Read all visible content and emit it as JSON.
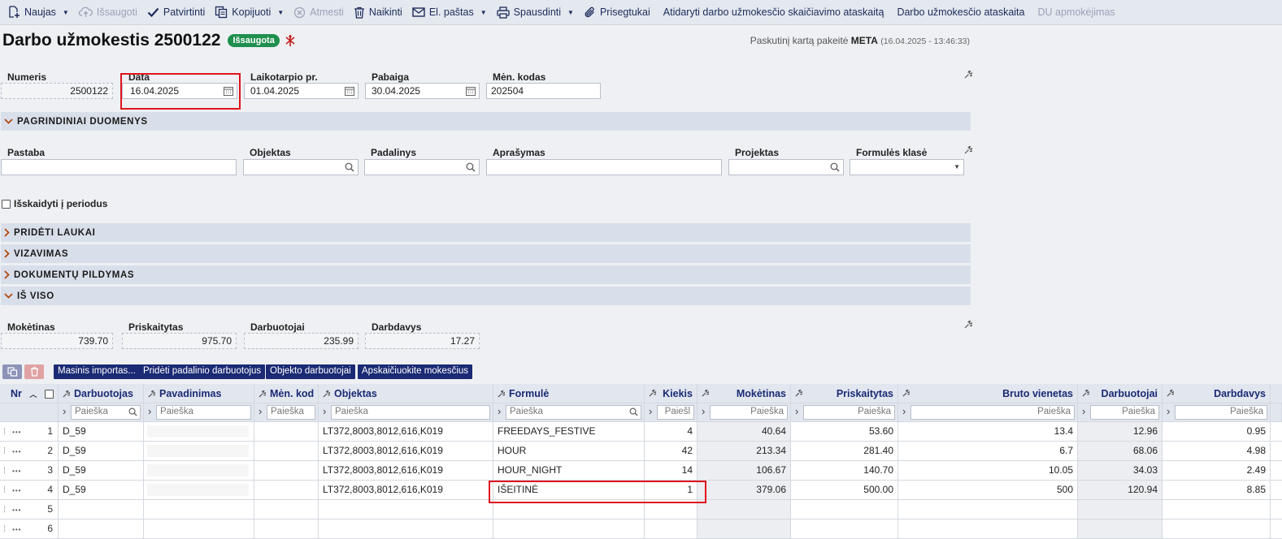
{
  "toolbar": {
    "new": "Naujas",
    "save": "Išsaugoti",
    "confirm": "Patvirtinti",
    "copy": "Kopijuoti",
    "cancel": "Atmesti",
    "delete": "Naikinti",
    "email": "El. paštas",
    "print": "Spausdinti",
    "attachments": "Prisegtukai",
    "report_calc": "Atidaryti darbo užmokesčio skaičiavimo ataskaitą",
    "report": "Darbo užmokesčio ataskaita",
    "payments": "DU apmokėjimas"
  },
  "header": {
    "title": "Darbo užmokestis 2500122",
    "status": "Išsaugota",
    "last_changed_prefix": "Paskutinį kartą pakeitė",
    "last_changed_user": "META",
    "last_changed_time": "(16.04.2025 - 13:46:33)"
  },
  "fields": {
    "number_label": "Numeris",
    "number": "2500122",
    "date_label": "Data",
    "date": "16.04.2025",
    "period_start_label": "Laikotarpio pr.",
    "period_start": "01.04.2025",
    "period_end_label": "Pabaiga",
    "period_end": "30.04.2025",
    "month_code_label": "Mėn. kodas",
    "month_code": "202504"
  },
  "sections": {
    "main": "PAGRINDINIAI DUOMENYS",
    "added": "PRIDĖTI LAUKAI",
    "approval": "VIZAVIMAS",
    "filling": "DOKUMENTŲ PILDYMAS",
    "total": "IŠ VISO"
  },
  "main_fields": {
    "note_label": "Pastaba",
    "note": "",
    "object_label": "Objektas",
    "object": "",
    "department_label": "Padalinys",
    "department": "",
    "description_label": "Aprašymas",
    "description": "",
    "project_label": "Projektas",
    "project": "",
    "formula_class_label": "Formulės klasė",
    "formula_class": ""
  },
  "split_period_label": "Išskaidyti į periodus",
  "totals": {
    "payable_label": "Mokėtinas",
    "payable": "739.70",
    "accrued_label": "Priskaitytas",
    "accrued": "975.70",
    "employees_label": "Darbuotojai",
    "employees": "235.99",
    "employer_label": "Darbdavys",
    "employer": "17.27"
  },
  "grid_buttons": {
    "mass_import": "Masinis importas...",
    "add_dept_employees": "Pridėti padalinio darbuotojus",
    "object_employees": "Objekto darbuotojai",
    "calc_taxes": "Apskaičiuokite mokesčius"
  },
  "grid": {
    "search_placeholder": "Paieška",
    "columns": {
      "nr": "Nr",
      "employee": "Darbuotojas",
      "name": "Pavadinimas",
      "month_code": "Mėn. kod",
      "object": "Objektas",
      "formula": "Formulė",
      "qty": "Kiekis",
      "payable": "Mokėtinas",
      "accrued": "Priskaitytas",
      "gross_unit": "Bruto vienetas",
      "employees": "Darbuotojai",
      "employer": "Darbdavys"
    },
    "qty_search_placeholder": "Paiešl",
    "rows": [
      {
        "nr": "1",
        "employee": "D_59",
        "object": "LT372,8003,8012,616,K019",
        "formula": "FREEDAYS_FESTIVE",
        "qty": "4",
        "payable": "40.64",
        "accrued": "53.60",
        "gross_unit": "13.4",
        "employees": "12.96",
        "employer": "0.95"
      },
      {
        "nr": "2",
        "employee": "D_59",
        "object": "LT372,8003,8012,616,K019",
        "formula": "HOUR",
        "qty": "42",
        "payable": "213.34",
        "accrued": "281.40",
        "gross_unit": "6.7",
        "employees": "68.06",
        "employer": "4.98"
      },
      {
        "nr": "3",
        "employee": "D_59",
        "object": "LT372,8003,8012,616,K019",
        "formula": "HOUR_NIGHT",
        "qty": "14",
        "payable": "106.67",
        "accrued": "140.70",
        "gross_unit": "10.05",
        "employees": "34.03",
        "employer": "2.49"
      },
      {
        "nr": "4",
        "employee": "D_59",
        "object": "LT372,8003,8012,616,K019",
        "formula": "IŠEITINĖ",
        "qty": "1",
        "payable": "379.06",
        "accrued": "500.00",
        "gross_unit": "500",
        "employees": "120.94",
        "employer": "8.85"
      },
      {
        "nr": "5",
        "employee": "",
        "object": "",
        "formula": "",
        "qty": "",
        "payable": "",
        "accrued": "",
        "gross_unit": "",
        "employees": "",
        "employer": ""
      },
      {
        "nr": "6",
        "employee": "",
        "object": "",
        "formula": "",
        "qty": "",
        "payable": "",
        "accrued": "",
        "gross_unit": "",
        "employees": "",
        "employer": ""
      }
    ]
  }
}
